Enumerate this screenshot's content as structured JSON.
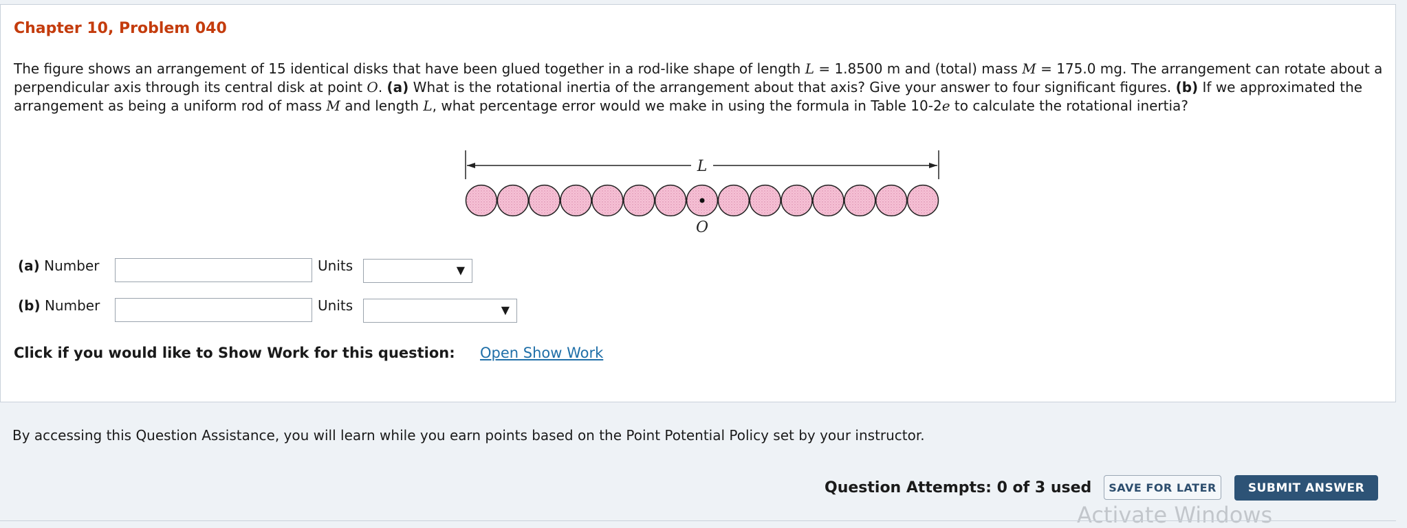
{
  "problem": {
    "title": "Chapter 10, Problem 040",
    "text_1": "The figure shows an arrangement of 15 identical disks that have been glued together in a rod-like shape of length ",
    "var_L": "L",
    "text_2": " = 1.8500 m and (total) mass ",
    "var_M": "M",
    "text_3": " = 175.0 mg. The arrangement can rotate about a perpendicular axis through its central disk at point ",
    "var_O": "O",
    "text_4": ". ",
    "part_a_tag": "(a)",
    "text_5": " What is the rotational inertia of the arrangement about that axis? Give your answer to four significant figures. ",
    "part_b_tag": "(b)",
    "text_6": " If we approximated the arrangement as being a uniform rod of mass ",
    "text_7": " and length ",
    "text_8": ", what percentage error would we make in using the formula in Table 10-2",
    "var_e": "e",
    "text_9": " to calculate the rotational inertia?"
  },
  "figure": {
    "length_label": "L",
    "point_label": "O",
    "disk_count": 15,
    "disk_color": "#f3b6cf"
  },
  "answers": {
    "a": {
      "tag": "(a)",
      "number_label": "Number",
      "number_value": "",
      "units_label": "Units",
      "units_value": ""
    },
    "b": {
      "tag": "(b)",
      "number_label": "Number",
      "number_value": "",
      "units_label": "Units",
      "units_value": ""
    }
  },
  "show_work": {
    "prompt": "Click if you would like to Show Work for this question:",
    "link": "Open Show Work"
  },
  "policy_text": "By accessing this Question Assistance, you will learn while you earn points based on the Point Potential Policy set by your instructor.",
  "footer": {
    "attempts": "Question Attempts: 0 of 3 used",
    "save_label": "SAVE FOR LATER",
    "submit_label": "SUBMIT ANSWER"
  },
  "watermark": "Activate Windows",
  "colors": {
    "title": "#c43c0d",
    "link": "#1f6fa8",
    "submit_bg": "#2d5376"
  }
}
